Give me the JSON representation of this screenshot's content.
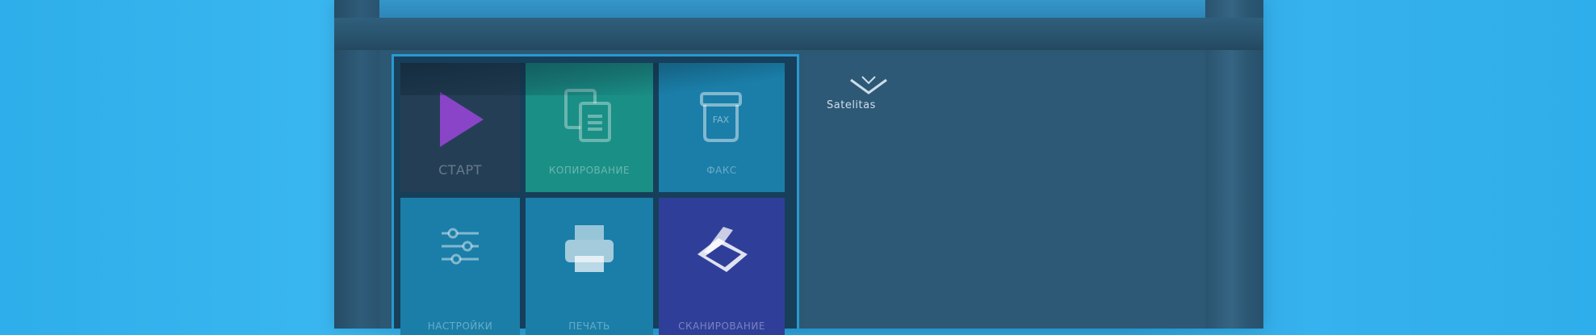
{
  "screen": {
    "brand_logo_text": "Satelitas",
    "tiles": [
      {
        "id": "start",
        "label": "СТАРТ",
        "icon": "play-icon"
      },
      {
        "id": "copy",
        "label": "КОПИРОВАНИЕ",
        "icon": "copy-icon"
      },
      {
        "id": "fax",
        "label": "ФАКС",
        "icon": "fax-icon"
      },
      {
        "id": "settings",
        "label": "НАСТРОЙКИ",
        "icon": "sliders-icon"
      },
      {
        "id": "print",
        "label": "ПЕЧАТЬ",
        "icon": "printer-icon"
      },
      {
        "id": "scan",
        "label": "СКАНИРОВАНИЕ",
        "icon": "scanner-icon"
      }
    ]
  },
  "colors": {
    "background": "#2eaeea",
    "device_body": "#2c5772",
    "tile_start": "#243f55",
    "tile_copy": "#1a8f86",
    "tile_blue": "#1a7ea8",
    "tile_scan": "#2f3f99",
    "play_accent": "#8a44c8"
  }
}
